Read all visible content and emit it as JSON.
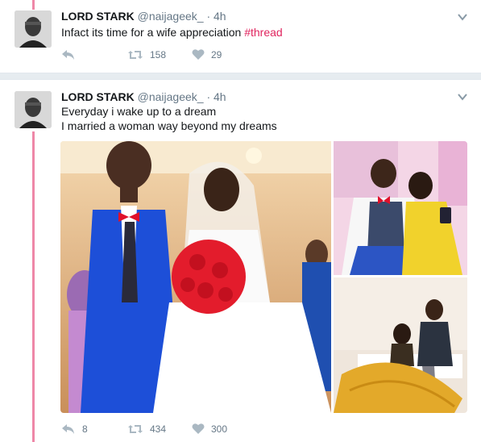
{
  "tweets": [
    {
      "author_name": "LORD STARK",
      "handle": "@naijageek_",
      "separator": "·",
      "time": "4h",
      "text": "Infact its time for a wife appreciation ",
      "hashtag": "#thread",
      "reply_count": "",
      "retweet_count": "158",
      "like_count": "29"
    },
    {
      "author_name": "LORD STARK",
      "handle": "@naijageek_",
      "separator": "·",
      "time": "4h",
      "text_line1": "Everyday i wake up to a dream",
      "text_line2": "I married a woman way beyond my dreams",
      "reply_count": "8",
      "retweet_count": "434",
      "like_count": "300"
    }
  ],
  "icons": {
    "reply": "reply-icon",
    "retweet": "retweet-icon",
    "like": "heart-icon",
    "menu": "chevron-down-icon"
  },
  "colors": {
    "accent_pink": "#e0245e",
    "muted_gray": "#657786",
    "icon_gray": "#aab8c2"
  }
}
